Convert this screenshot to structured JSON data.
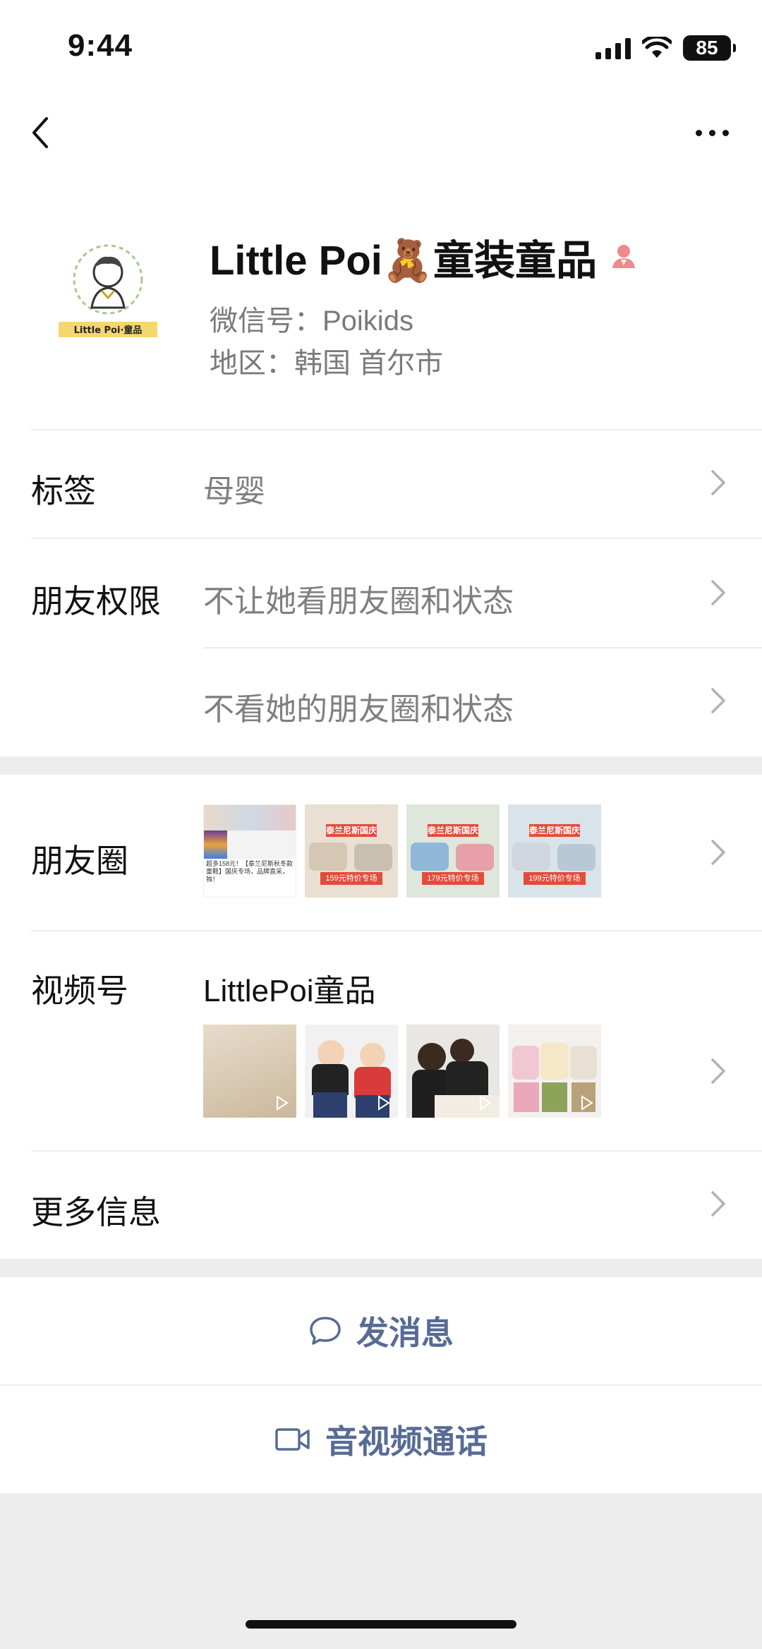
{
  "status_bar": {
    "time": "9:44",
    "battery": "85",
    "icons": [
      "signal-icon",
      "wifi-icon",
      "battery-icon"
    ]
  },
  "navbar": {
    "back_icon": "chevron-left-icon",
    "more_icon": "more-dots-icon"
  },
  "profile": {
    "name": "Little Poi🧸童装童品",
    "wechat_id": "微信号：Poikids",
    "region": "地区：韩国 首尔市",
    "avatar_logo_text": "Little Poi·童品",
    "gender_icon": "female-icon"
  },
  "tags": {
    "label": "标签",
    "value": "母婴"
  },
  "permissions": {
    "label": "朋友权限",
    "items": [
      "不让她看朋友圈和状态",
      "不看她的朋友圈和状态"
    ]
  },
  "moments": {
    "label": "朋友圈",
    "thumbs": [
      {
        "caption": "超多158元！【泰兰尼斯秋冬款童鞋】国庆专场，品牌直采，独！",
        "sub": ""
      },
      {
        "caption": "泰兰尼斯国庆",
        "sub": "159元特价专场"
      },
      {
        "caption": "泰兰尼斯国庆",
        "sub": "179元特价专场"
      },
      {
        "caption": "泰兰尼斯国庆",
        "sub": "199元特价专场"
      }
    ]
  },
  "channels": {
    "label": "视频号",
    "name": "LittlePoi童品"
  },
  "more_info": {
    "label": "更多信息"
  },
  "actions": {
    "message": "发消息",
    "call": "音视频通话"
  },
  "colors": {
    "link": "#576b95",
    "badge": "#f08a8a",
    "bg": "#ededed"
  }
}
